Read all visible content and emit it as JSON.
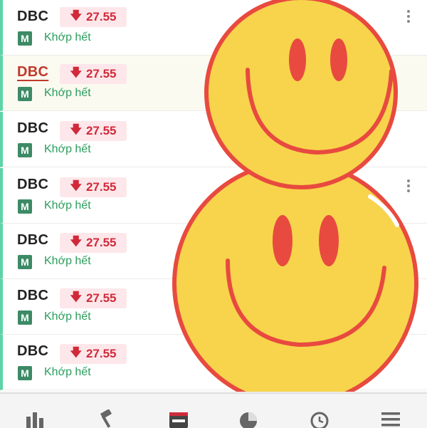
{
  "orders": [
    {
      "ticker": "DBC",
      "price": "27.55",
      "badge": "M",
      "status": "Khớp hết"
    },
    {
      "ticker": "DBC",
      "price": "27.55",
      "badge": "M",
      "status": "Khớp hết"
    },
    {
      "ticker": "DBC",
      "price": "27.55",
      "badge": "M",
      "status": "Khớp hết"
    },
    {
      "ticker": "DBC",
      "price": "27.55",
      "badge": "M",
      "status": "Khớp hết"
    },
    {
      "ticker": "DBC",
      "price": "27.55",
      "badge": "M",
      "status": "Khớp hết"
    },
    {
      "ticker": "DBC",
      "price": "27.55",
      "badge": "M",
      "status": "Khớp hết"
    },
    {
      "ticker": "DBC",
      "price": "27.55",
      "badge": "M",
      "status": "Khớp hết"
    }
  ],
  "icons": {
    "price_direction": "arrow-down-icon",
    "more": "kebab-menu-icon"
  },
  "bottom_nav": [
    {
      "icon": "market-chart-icon"
    },
    {
      "icon": "gavel-order-icon"
    },
    {
      "icon": "wallet-icon"
    },
    {
      "icon": "pie-chart-icon"
    },
    {
      "icon": "clock-history-icon"
    },
    {
      "icon": "hamburger-menu-icon"
    }
  ],
  "colors": {
    "accent_green": "#5fd3a8",
    "price_down": "#d02a3a",
    "price_bg": "#fde7ea",
    "badge_green": "#3c8a66",
    "status_green": "#2a9d5c",
    "smiley_yellow": "#f7d44c",
    "smiley_red": "#e84a3f"
  }
}
